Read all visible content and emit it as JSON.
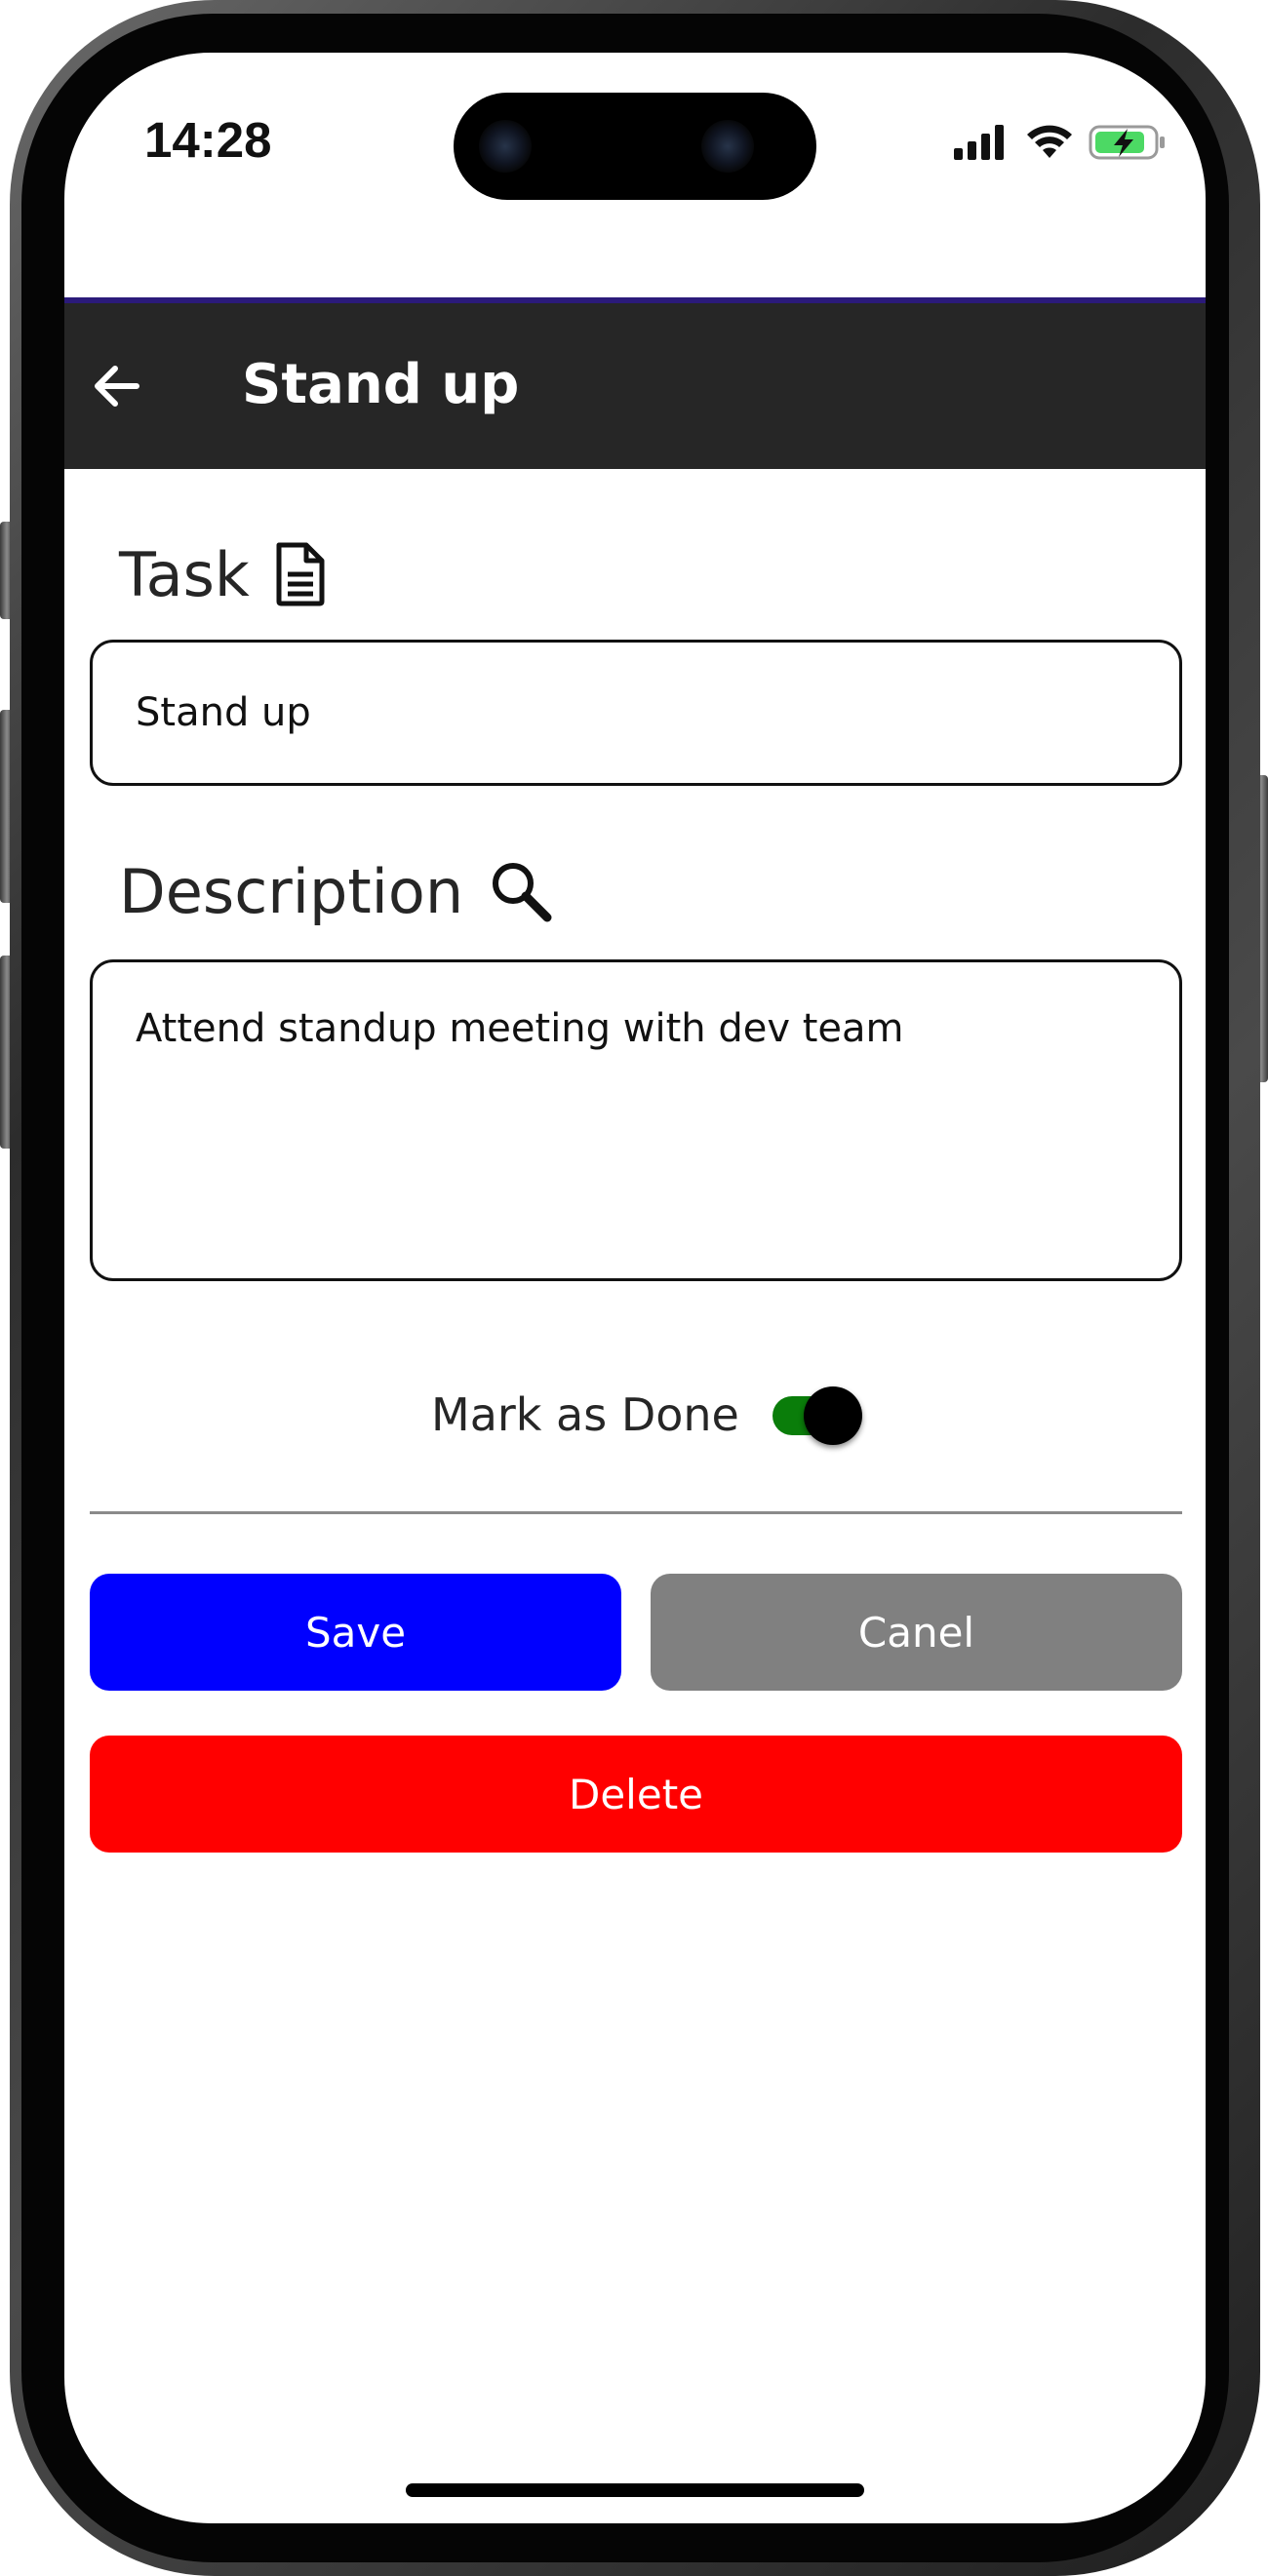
{
  "status_bar": {
    "time": "14:28",
    "icons": [
      "signal-icon",
      "wifi-icon",
      "battery-charging-icon"
    ]
  },
  "header": {
    "back_icon": "arrow-left-icon",
    "title": "Stand up",
    "background": "#262626",
    "accent": "#2b1a7a"
  },
  "form": {
    "task": {
      "label": "Task",
      "icon": "document-icon",
      "value": "Stand up"
    },
    "description": {
      "label": "Description",
      "icon": "search-icon",
      "value": "Attend standup meeting with dev team"
    },
    "done_toggle": {
      "label": "Mark as Done",
      "checked": true,
      "track_color": "#0a7d0a"
    }
  },
  "buttons": {
    "save": {
      "label": "Save",
      "color": "#0000ff"
    },
    "cancel": {
      "label": "Canel",
      "color": "#808080"
    },
    "delete": {
      "label": "Delete",
      "color": "#ff0000"
    }
  }
}
